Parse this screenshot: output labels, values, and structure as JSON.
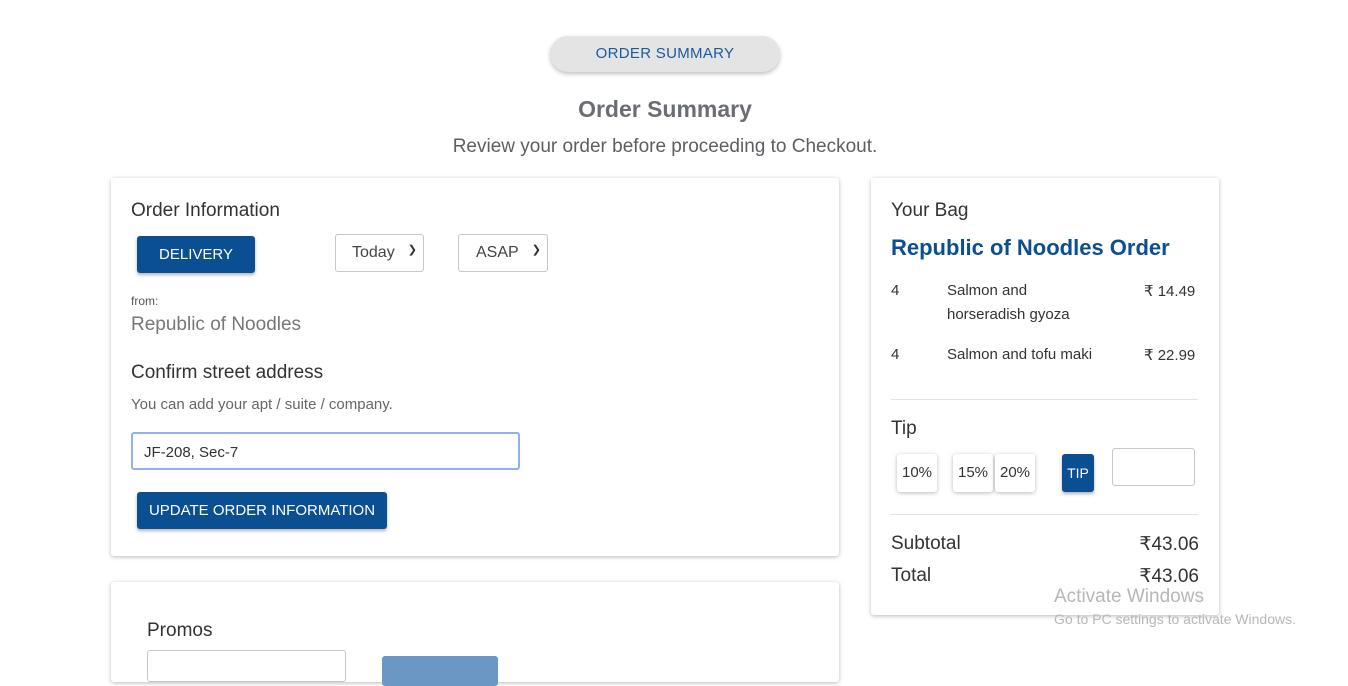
{
  "header": {
    "pill_label": "ORDER SUMMARY",
    "title": "Order Summary",
    "subtitle": "Review your order before proceeding to Checkout."
  },
  "order_info": {
    "heading": "Order Information",
    "delivery_button": "DELIVERY",
    "day_select": "Today",
    "time_select": "ASAP",
    "from_label": "from:",
    "restaurant": "Republic of Noodles",
    "address_heading": "Confirm street address",
    "address_hint": "You can add your apt / suite / company.",
    "address_value": "JF-208, Sec-7",
    "update_button": "UPDATE ORDER INFORMATION"
  },
  "promos": {
    "heading": "Promos"
  },
  "bag": {
    "heading": "Your Bag",
    "order_title": "Republic of Noodles Order",
    "items": [
      {
        "qty": "4",
        "name_line1": "Salmon and",
        "name_line2": "horseradish gyoza",
        "price": "₹ 14.49"
      },
      {
        "qty": "4",
        "name_line1": "Salmon and tofu maki",
        "name_line2": "",
        "price": "₹ 22.99"
      }
    ],
    "tip_heading": "Tip",
    "tip_options": [
      "10%",
      "15%",
      "20%"
    ],
    "tip_button": "TIP",
    "tip_input": "",
    "subtotal_label": "Subtotal",
    "subtotal_value": "₹43.06",
    "total_label": "Total",
    "total_value": "₹43.06"
  },
  "watermark": {
    "line1": "Activate Windows",
    "line2": "Go to PC settings to activate Windows."
  },
  "colors": {
    "primary": "#0b4f93",
    "title_blue": "#0b4f93",
    "pill_bg": "#e4e4e4"
  }
}
